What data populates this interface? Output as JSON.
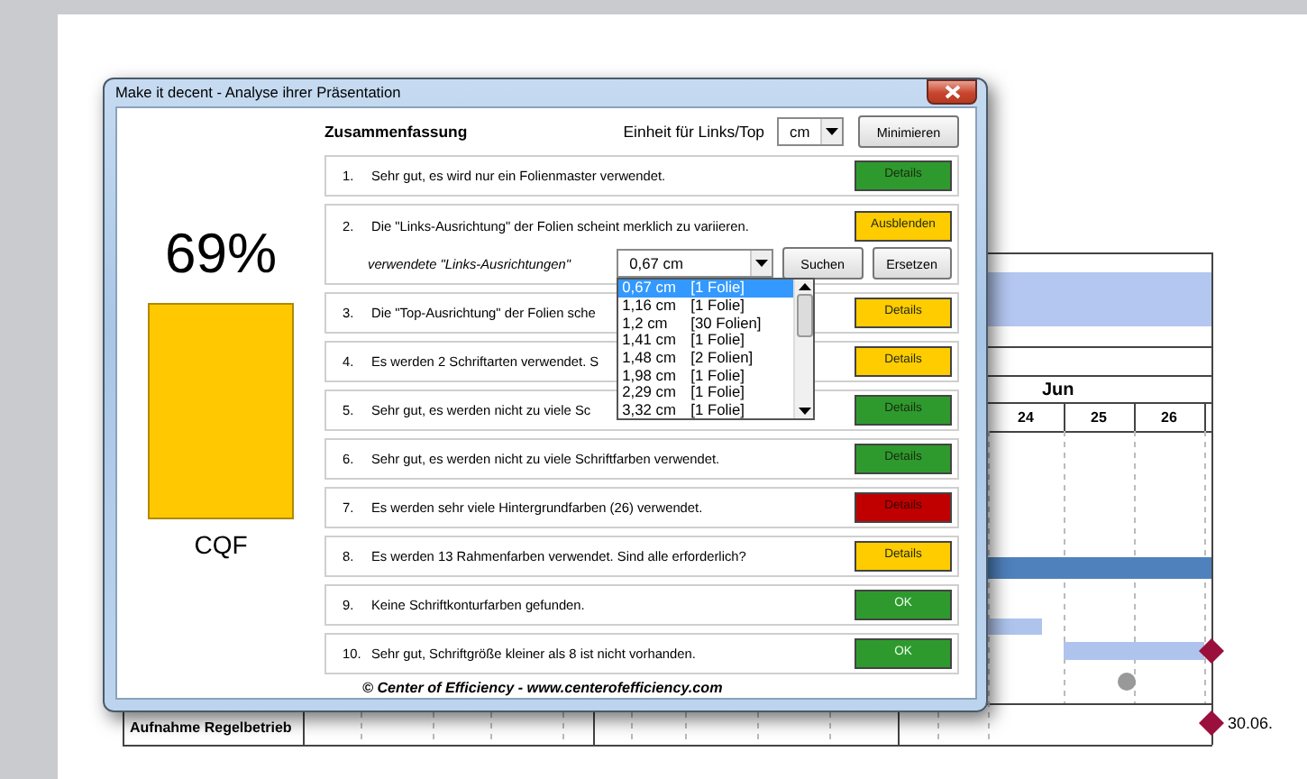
{
  "gantt": {
    "month": "Jun",
    "days": [
      "24",
      "25",
      "26"
    ],
    "rows": [
      {
        "label": "Aufnahme Regelbetrieb",
        "date": "30.06."
      }
    ]
  },
  "dialog": {
    "title": "Make it decent - Analyse ihrer Präsentation",
    "score": {
      "value": "69%",
      "label": "CQF"
    },
    "heading": "Zusammenfassung",
    "unit_label": "Einheit für Links/Top",
    "unit": "cm",
    "minimize_button": "Minimieren",
    "items": [
      {
        "number": "1.",
        "text": "Sehr gut, es wird nur ein Folienmaster verwendet.",
        "button": "Details",
        "kind": "details",
        "color": "#2e9a2e"
      },
      {
        "number": "2.",
        "text": "Die \"Links-Ausrichtung\" der Folien scheint merklich zu variieren.",
        "button": "Ausblenden",
        "kind": "details",
        "color": "#ffcc00",
        "detail": {
          "label": "verwendete \"Links-Ausrichtungen\"",
          "value": "0,67 cm",
          "search_button": "Suchen",
          "replace_button": "Ersetzen",
          "options": [
            {
              "value": "0,67 cm",
              "slides": "[1 Folie]",
              "selected": true
            },
            {
              "value": "1,16 cm",
              "slides": "[1 Folie]",
              "selected": false
            },
            {
              "value": "1,2 cm",
              "slides": "[30 Folien]",
              "selected": false
            },
            {
              "value": "1,41 cm",
              "slides": "[1 Folie]",
              "selected": false
            },
            {
              "value": "1,48 cm",
              "slides": "[2 Folien]",
              "selected": false
            },
            {
              "value": "1,98 cm",
              "slides": "[1 Folie]",
              "selected": false
            },
            {
              "value": "2,29 cm",
              "slides": "[1 Folie]",
              "selected": false
            },
            {
              "value": "3,32 cm",
              "slides": "[1 Folie]",
              "selected": false
            }
          ]
        }
      },
      {
        "number": "3.",
        "text": "Die \"Top-Ausrichtung\" der Folien sche",
        "button": "Details",
        "kind": "details",
        "color": "#ffcc00"
      },
      {
        "number": "4.",
        "text": "Es werden 2 Schriftarten verwendet. S",
        "button": "Details",
        "kind": "details",
        "color": "#ffcc00"
      },
      {
        "number": "5.",
        "text": "Sehr gut, es werden nicht zu viele Sc",
        "button": "Details",
        "kind": "details",
        "color": "#2e9a2e"
      },
      {
        "number": "6.",
        "text": "Sehr gut, es werden nicht zu viele Schriftfarben verwendet.",
        "button": "Details",
        "kind": "details",
        "color": "#2e9a2e"
      },
      {
        "number": "7.",
        "text": "Es werden sehr viele Hintergrundfarben (26) verwendet.",
        "button": "Details",
        "kind": "details",
        "color": "#c00000"
      },
      {
        "number": "8.",
        "text": "Es werden 13 Rahmenfarben verwendet. Sind alle erforderlich?",
        "button": "Details",
        "kind": "details",
        "color": "#ffcc00"
      },
      {
        "number": "9.",
        "text": "Keine Schriftkonturfarben gefunden.",
        "button": "OK",
        "kind": "ok",
        "color": "#2e9a2e"
      },
      {
        "number": "10.",
        "text": "Sehr gut, Schriftgröße kleiner als 8 ist nicht vorhanden.",
        "button": "OK",
        "kind": "ok",
        "color": "#2e9a2e"
      }
    ],
    "footer": "© Center of Efficiency - www.centerofefficiency.com"
  }
}
